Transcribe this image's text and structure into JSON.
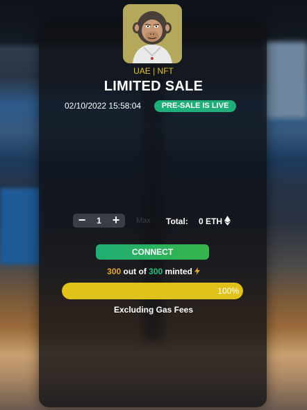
{
  "header": {
    "avatar_icon": "ape-nft-avatar",
    "tagline": "UAE | NFT",
    "title": "LIMITED SALE",
    "datetime": "02/10/2022 15:58:04",
    "status_badge": "PRE-SALE IS LIVE"
  },
  "mint": {
    "minus_label": "−",
    "quantity": "1",
    "plus_label": "+",
    "max_hint": "Max",
    "total_label": "Total:",
    "total_value": "0 ETH",
    "currency_icon": "ethereum-icon"
  },
  "actions": {
    "connect_label": "CONNECT"
  },
  "supply": {
    "minted_count": "300",
    "out_of_text": " out of ",
    "total_supply": "300",
    "minted_text": " minted",
    "progress_percent": 100,
    "progress_label": "100%"
  },
  "footer": {
    "gas_note": "Excluding Gas Fees"
  },
  "colors": {
    "accent_gold": "#e5c12a",
    "live_green": "#1fae7a",
    "connect_green": "#37b54a",
    "progress_yellow": "#e1c21a"
  }
}
